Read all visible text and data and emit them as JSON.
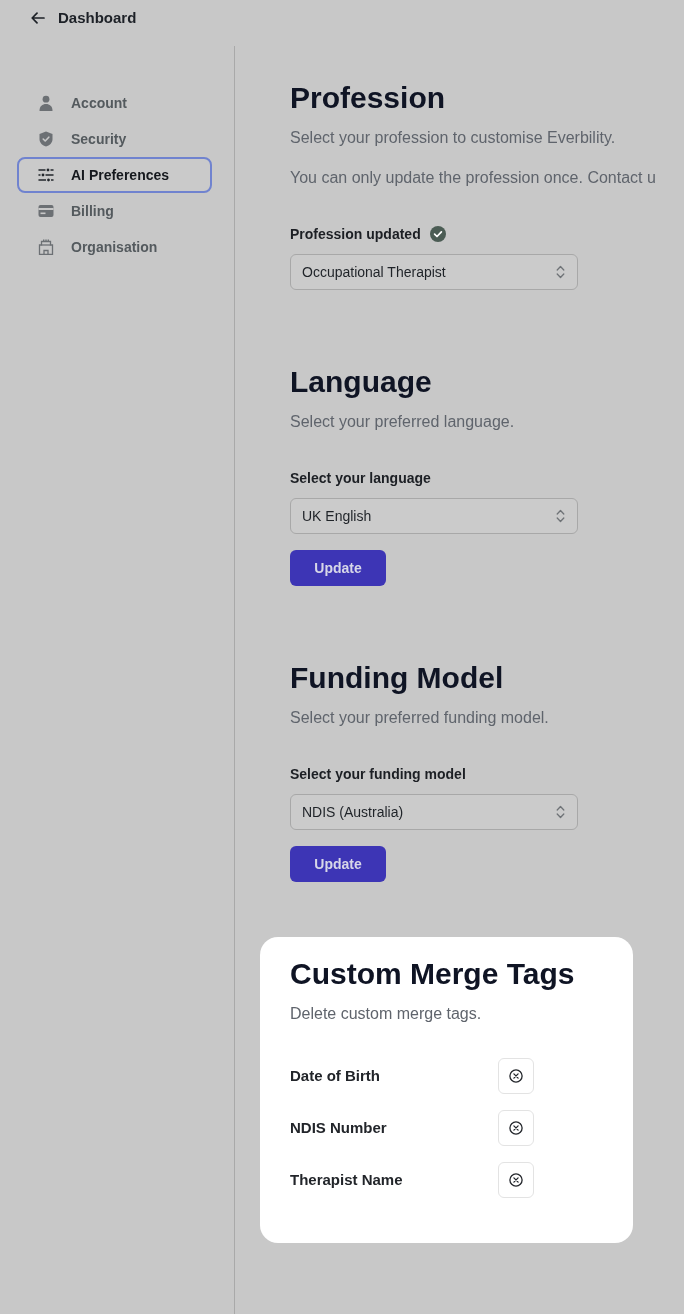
{
  "back_link": {
    "label": "Dashboard"
  },
  "sidebar": {
    "items": [
      {
        "label": "Account",
        "selected": false
      },
      {
        "label": "Security",
        "selected": false
      },
      {
        "label": "AI Preferences",
        "selected": true
      },
      {
        "label": "Billing",
        "selected": false
      },
      {
        "label": "Organisation",
        "selected": false
      }
    ]
  },
  "sections": [
    {
      "title": "Profession",
      "descriptions": [
        "Select your profession to customise Everbility.",
        "You can only update the profession once. Contact u"
      ],
      "field": {
        "label": "Profession updated",
        "confirmed": true,
        "value": "Occupational Therapist"
      }
    },
    {
      "title": "Language",
      "descriptions": [
        "Select your preferred language."
      ],
      "field": {
        "label": "Select your language",
        "confirmed": false,
        "value": "UK English"
      },
      "button": "Update"
    },
    {
      "title": "Funding Model",
      "descriptions": [
        "Select your preferred funding model."
      ],
      "field": {
        "label": "Select your funding model",
        "confirmed": false,
        "value": "NDIS (Australia)"
      },
      "button": "Update"
    }
  ],
  "merge_tags": {
    "highlighted": true,
    "title": "Custom Merge Tags",
    "description": "Delete custom merge tags.",
    "tags": [
      {
        "label": "Date of Birth"
      },
      {
        "label": "NDIS Number"
      },
      {
        "label": "Therapist Name"
      }
    ]
  }
}
